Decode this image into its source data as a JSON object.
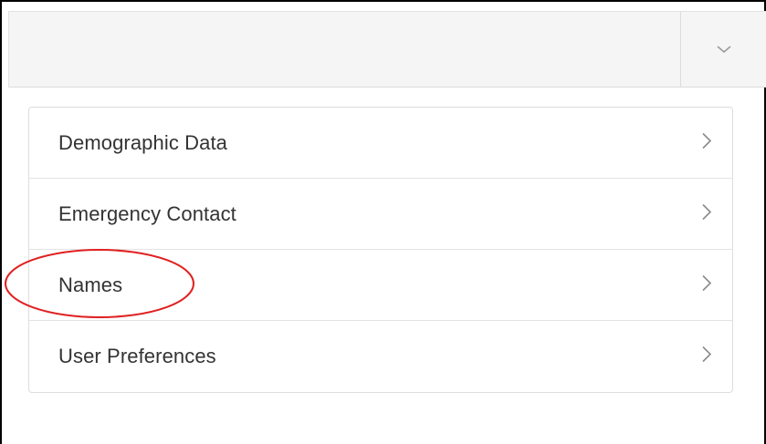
{
  "header": {
    "toggle_icon": "chevron-down-icon"
  },
  "menu": {
    "items": [
      {
        "label": "Demographic Data",
        "icon": "chevron-right-icon"
      },
      {
        "label": "Emergency Contact",
        "icon": "chevron-right-icon"
      },
      {
        "label": "Names",
        "icon": "chevron-right-icon"
      },
      {
        "label": "User Preferences",
        "icon": "chevron-right-icon"
      }
    ]
  },
  "annotation": {
    "type": "red-ellipse",
    "target": "Names",
    "color": "#e02020"
  },
  "colors": {
    "header_bg": "#f5f5f5",
    "border": "#dddddd",
    "text": "#333333",
    "chevron": "#8a8a8a"
  }
}
